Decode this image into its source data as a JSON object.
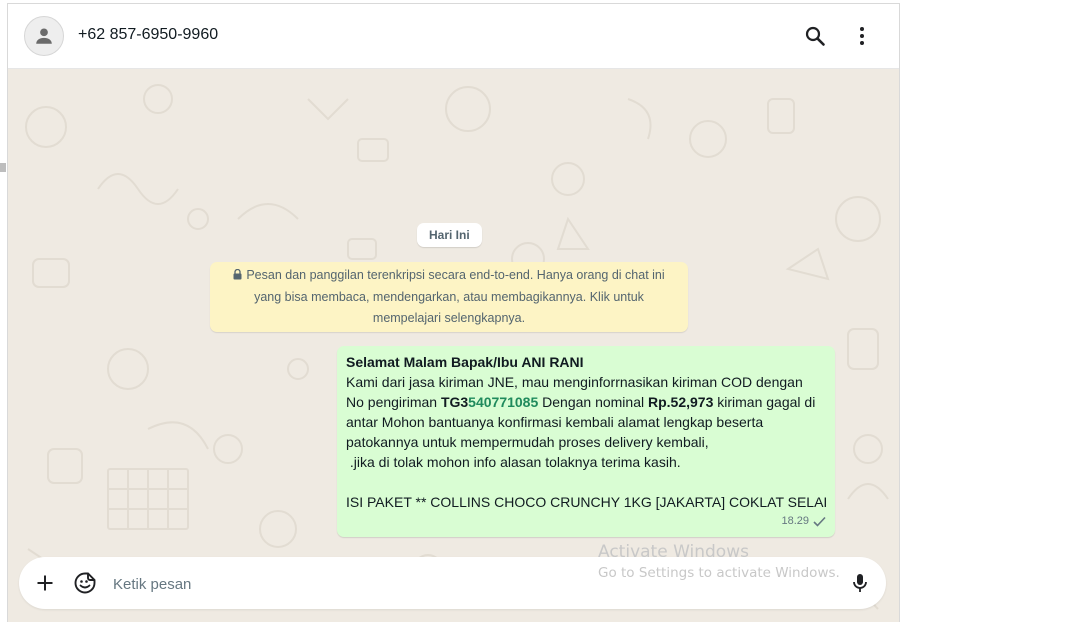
{
  "header": {
    "contact_name": "+62 857-6950-9960",
    "icons": [
      "person-avatar-icon",
      "search-icon",
      "more-vert-icon"
    ]
  },
  "chat": {
    "date_chip": "Hari Ini",
    "encryption_notice": {
      "icon": "lock-icon",
      "text": "Pesan dan panggilan terenkripsi secara end-to-end. Hanya orang di chat ini yang bisa membaca, mendengarkan, atau membagikannya. Klik untuk mempelajari selengkapnya."
    },
    "message": {
      "greeting": "Selamat Malam Bapak/Ibu ANI RANI",
      "line1": "Kami dari jasa kiriman JNE, mau menginforrnasikan kiriman COD dengan",
      "line2_prefix": "No pengiriman ",
      "tracking_prefix": "TG3",
      "tracking_number": "540771085",
      "line2_mid": " Dengan nominal ",
      "amount": "Rp.52,973",
      "line2_suffix": " kiriman gagal di",
      "line3": "antar Mohon bantuanya konfirmasi kembali alamat lengkap beserta",
      "line4": "patokannya untuk mempermudah proses delivery kembali,",
      "line5": " .jika di tolak mohon info alasan tolaknya terima kasih.",
      "line6": "ISI PAKET ** COLLINS CHOCO CRUNCHY 1KG [JAKARTA] COKLAT SELAI",
      "time": "18.29",
      "status_icon": "single-check-icon"
    }
  },
  "composer": {
    "placeholder": "Ketik pesan",
    "value": "",
    "icons": [
      "plus-icon",
      "sticker-icon",
      "mic-icon"
    ]
  },
  "watermark": {
    "line1": "Activate Windows",
    "line2": "Go to Settings to activate Windows."
  },
  "colors": {
    "chat_background": "#efeae2",
    "outgoing_bubble": "#d9fdd3",
    "notice_background": "#fdf4c5",
    "header_background": "#ffffff"
  }
}
